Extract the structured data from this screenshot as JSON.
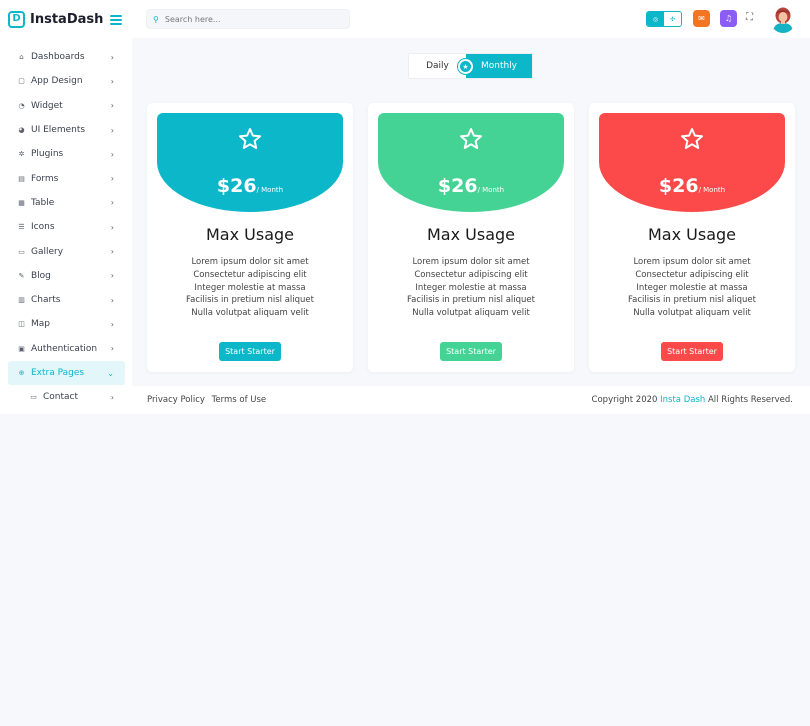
{
  "brand": {
    "name": "InstaDash",
    "mark": "D"
  },
  "search": {
    "placeholder": "Search here..."
  },
  "sidebar": {
    "items": [
      {
        "label": "Dashboards",
        "icon": "home-icon"
      },
      {
        "label": "App Design",
        "icon": "app-design-icon"
      },
      {
        "label": "Widget",
        "icon": "widget-icon"
      },
      {
        "label": "UI Elements",
        "icon": "ui-elements-icon"
      },
      {
        "label": "Plugins",
        "icon": "plugins-icon"
      },
      {
        "label": "Forms",
        "icon": "forms-icon"
      },
      {
        "label": "Table",
        "icon": "table-icon"
      },
      {
        "label": "Icons",
        "icon": "icons-icon"
      },
      {
        "label": "Gallery",
        "icon": "gallery-icon"
      },
      {
        "label": "Blog",
        "icon": "blog-icon"
      },
      {
        "label": "Charts",
        "icon": "charts-icon"
      },
      {
        "label": "Map",
        "icon": "map-icon"
      },
      {
        "label": "Authentication",
        "icon": "lock-icon"
      },
      {
        "label": "Extra Pages",
        "icon": "extra-pages-icon"
      },
      {
        "label": "Contact",
        "icon": "contact-icon"
      }
    ]
  },
  "pricing_toggle": {
    "daily": "Daily",
    "monthly": "Monthly",
    "selected": "Monthly"
  },
  "cards": [
    {
      "price": "$26",
      "period": "/ Month",
      "title": "Max Usage",
      "features": [
        "Lorem ipsum dolor sit amet",
        "Consectetur adipiscing elit",
        "Integer molestie at massa",
        "Facilisis in pretium nisl aliquet",
        "Nulla volutpat aliquam velit"
      ],
      "button": "Start Starter",
      "color": "#0bb7c9"
    },
    {
      "price": "$26",
      "period": "/ Month",
      "title": "Max Usage",
      "features": [
        "Lorem ipsum dolor sit amet",
        "Consectetur adipiscing elit",
        "Integer molestie at massa",
        "Facilisis in pretium nisl aliquet",
        "Nulla volutpat aliquam velit"
      ],
      "button": "Start Starter",
      "color": "#45d395"
    },
    {
      "price": "$26",
      "period": "/ Month",
      "title": "Max Usage",
      "features": [
        "Lorem ipsum dolor sit amet",
        "Consectetur adipiscing elit",
        "Integer molestie at massa",
        "Facilisis in pretium nisl aliquet",
        "Nulla volutpat aliquam velit"
      ],
      "button": "Start Starter",
      "color": "#fc4a4a"
    }
  ],
  "footer": {
    "privacy": "Privacy Policy",
    "terms": "Terms of Use",
    "copy_prefix": "Copyright 2020",
    "copy_brand": "Insta Dash",
    "copy_suffix": "All Rights Reserved."
  },
  "colors": {
    "accent": "#0bb7c9",
    "mail": "#f47521",
    "bell": "#8b5cf6"
  }
}
